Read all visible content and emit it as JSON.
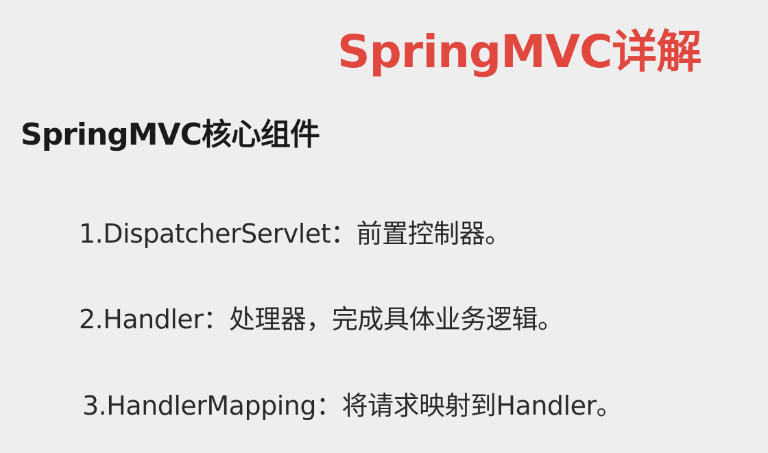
{
  "slide": {
    "title": "SpringMVC详解",
    "heading": "SpringMVC核心组件",
    "items": [
      "1.DispatcherServlet：前置控制器。",
      "2.Handler：处理器，完成具体业务逻辑。",
      "3.HandlerMapping：将请求映射到Handler。"
    ]
  },
  "colors": {
    "title": "#e0483f",
    "heading": "#1a1a1a",
    "body": "#2a2a2a",
    "background": "#eeeeee"
  }
}
